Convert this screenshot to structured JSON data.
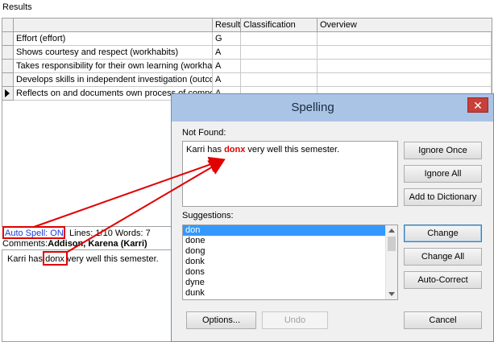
{
  "results": {
    "label": "Results",
    "columns": [
      "Result",
      "Classification",
      "Overview"
    ],
    "rows": [
      {
        "name": "Effort (effort)",
        "result": "G",
        "current": false
      },
      {
        "name": "Shows courtesy and respect (workhabits)",
        "result": "A",
        "current": false
      },
      {
        "name": "Takes responsibility for their own learning (workhab",
        "result": "A",
        "current": false
      },
      {
        "name": "Develops skills in independent investigation (outcor",
        "result": "A",
        "current": false
      },
      {
        "name": "Reflects on and documents own process of compos",
        "result": "A",
        "current": true
      }
    ]
  },
  "status": {
    "auto_spell": "Auto Spell: ON",
    "lines_words": "Lines: 1/10 Words: 7"
  },
  "comments": {
    "label": "Comments:",
    "student": "Addison, Karena (Karri)",
    "text_before": "Karri has ",
    "misspelled": "donx",
    "text_after": " very well this semester."
  },
  "spelling_dialog": {
    "title": "Spelling",
    "close_glyph": "✕",
    "not_found_label": "Not Found:",
    "not_found_before": "Karri has ",
    "not_found_word": "donx",
    "not_found_after": " very well this semester.",
    "suggestions_label": "Suggestions:",
    "suggestions": [
      "don",
      "done",
      "dong",
      "donk",
      "dons",
      "dyne",
      "dunk"
    ],
    "selected_suggestion": "don",
    "buttons": {
      "ignore_once": "Ignore Once",
      "ignore_all": "Ignore All",
      "add_to_dictionary": "Add to Dictionary",
      "change": "Change",
      "change_all": "Change All",
      "auto_correct": "Auto-Correct",
      "options": "Options...",
      "undo": "Undo",
      "cancel": "Cancel"
    }
  },
  "colors": {
    "annotation_red": "#e00000",
    "titlebar": "#aac4e6",
    "selection": "#3399ff",
    "auto_spell_blue": "#1a3bd4"
  }
}
